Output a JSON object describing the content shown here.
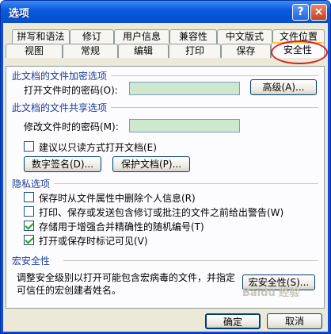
{
  "window": {
    "title": "选项",
    "help_glyph": "?",
    "close_glyph": "×"
  },
  "tabs_row1": [
    {
      "label": "拼写和语法"
    },
    {
      "label": "修订"
    },
    {
      "label": "用户信息"
    },
    {
      "label": "兼容性"
    },
    {
      "label": "中文版式"
    },
    {
      "label": "文件位置"
    }
  ],
  "tabs_row2": [
    {
      "label": "视图"
    },
    {
      "label": "常规"
    },
    {
      "label": "编辑"
    },
    {
      "label": "打印"
    },
    {
      "label": "保存"
    },
    {
      "label": "安全性",
      "active": true
    }
  ],
  "encrypt": {
    "section_title": "此文档的文件加密选项",
    "open_password_label": "打开文件时的密码(O):",
    "open_password_value": "",
    "advanced_button": "高级(A)..."
  },
  "sharing": {
    "section_title": "此文档的文件共享选项",
    "modify_password_label": "修改文件时的密码(M):",
    "modify_password_value": "",
    "readonly_label": "建议以只读方式打开文档(E)",
    "readonly_checked": false,
    "digital_signature_button": "数字签名(D)...",
    "protect_document_button": "保护文档(P)..."
  },
  "privacy": {
    "section_title": "隐私选项",
    "options": [
      {
        "label": "保存时从文件属性中删除个人信息(R)",
        "checked": false
      },
      {
        "label": "打印、保存或发送包含修订或批注的文件之前给出警告(W)",
        "checked": false
      },
      {
        "label": "存储用于增强合并精确性的随机编号(T)",
        "checked": true
      },
      {
        "label": "打开或保存时标记可见(V)",
        "checked": true
      }
    ]
  },
  "macro": {
    "section_title": "宏安全性",
    "description": "调整安全级别以打开可能包含宏病毒的文件，并指定可信任的宏创建者姓名。",
    "macro_button": "宏安全性(S)..."
  },
  "footer": {
    "ok_button": "确定",
    "cancel_button": "取消"
  },
  "watermark": "Baidu 经验",
  "colors": {
    "title_bar": "#0a5ce0",
    "section_title": "#1f3a93",
    "password_field": "#cfe6cf",
    "annotation_ring": "#d52222"
  }
}
